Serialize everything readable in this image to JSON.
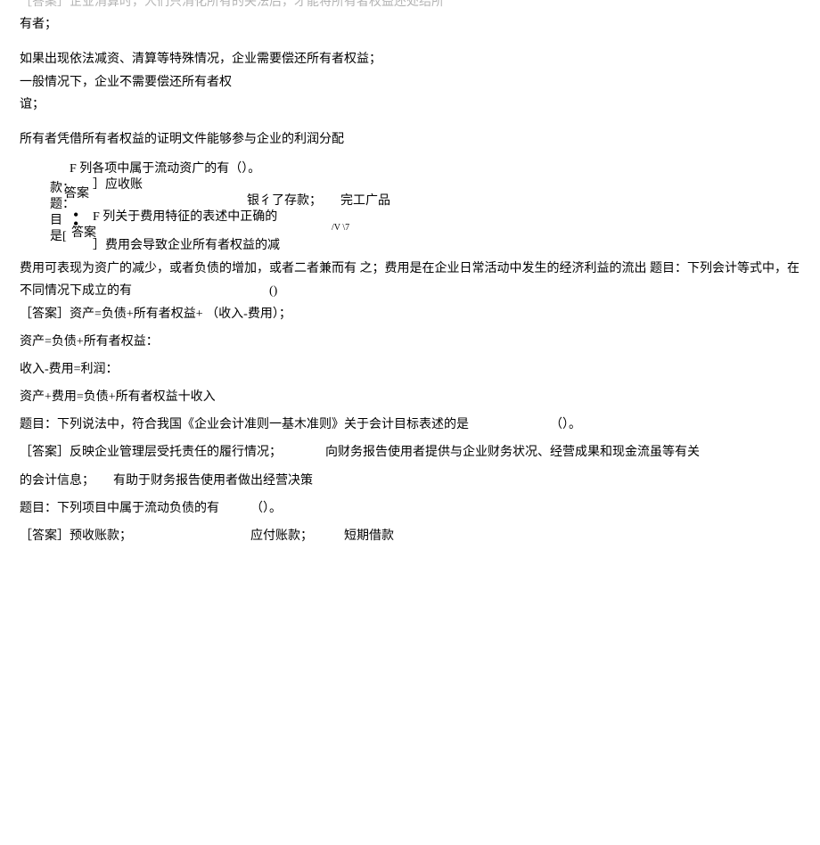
{
  "cutoff": "［答案］企业消算时，人们只消化所有的夹法后，才能将所有者权益还处结所",
  "p1": "有者；",
  "p2": "如果出现依法减资、清算等特殊情况，企业需要偿还所有者权益；",
  "p3": "一般情况下，企业不需要偿还所有者权",
  "p4": "谊；",
  "p5": "所有者凭借所有者权益的证明文件能够参与企业的利润分配",
  "cz": {
    "a": "F 列各项中属于流动资广的有（）。",
    "b": "款",
    "c": "题",
    "d": "目",
    "e": "是",
    "f": "[",
    "g": "答案",
    "h": "答案",
    "i": "］应收账",
    "j": "银彳了存款；　　完工广品",
    "k": "F 列关于费用特征的表述中正确的",
    "l": "/V \\7",
    "m": "］费用会导致企业所有者权益的减",
    "dot1": "•",
    "dot2": "•",
    "colon1": "：",
    "colon2": "："
  },
  "p6": "费用可表现为资广的减少，或者负债的增加，或者二者兼而有 之；费用是在企业日常活动中发生的经济利益的流出 题目：下列会计等式中，在不同情况下成立的有　　　　　　　　　　　()",
  "p7": "［答案］资产=负债+所有者权益+ （收入-费用）；",
  "p8": "资产=负债+所有者权益：",
  "p9": "收入-费用=利润：",
  "p10": "资产+费用=负债+所有者权益十收入",
  "p11": "题目：下列说法中，符合我国《企业会计准则一基木准则》关于会计目标表述的是　　　　　　　（）。",
  "p12": "［答案］反映企业管理层受托责任的履行情况；　　　　向财务报告使用者提供与企业财务状况、经营成果和现金流虽等有关",
  "p13": "的会计信息；　　有助于财务报告使用者做出经营决策",
  "p14": "题目：下列项目中属于流动负债的有　　　（）。",
  "p15": "［答案］预收账款；　　　　　　　　　　应付账款；　　　短期借款"
}
